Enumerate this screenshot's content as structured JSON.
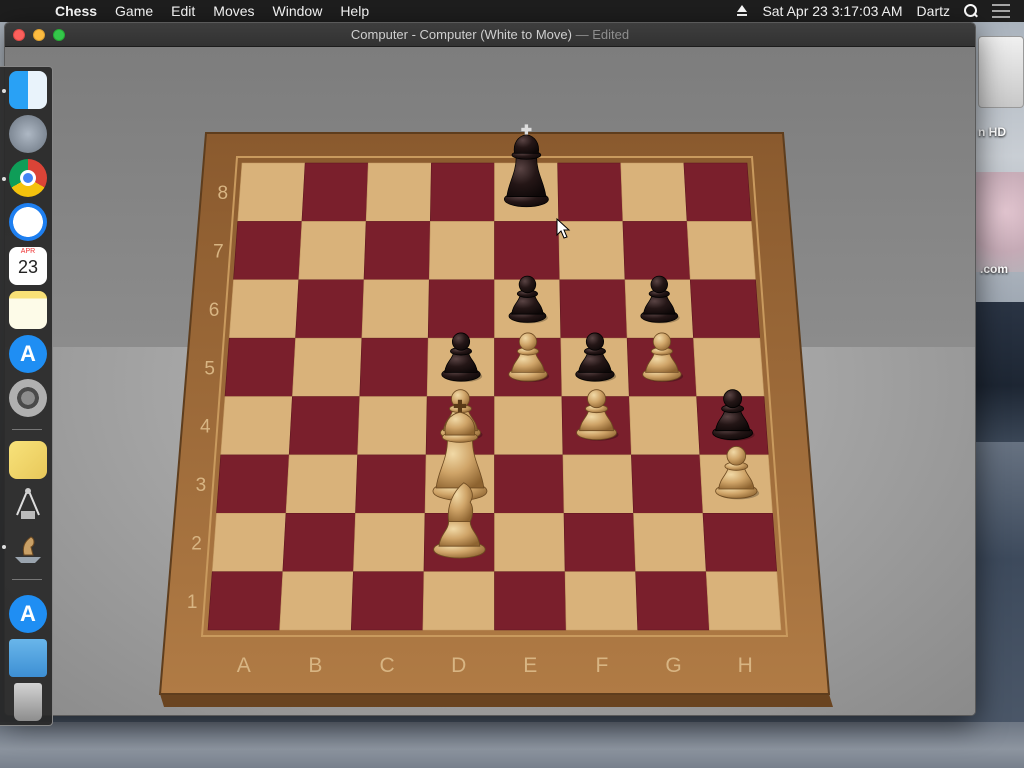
{
  "menubar": {
    "app_name": "Chess",
    "items": [
      "Game",
      "Edit",
      "Moves",
      "Window",
      "Help"
    ],
    "clock": "Sat Apr 23  3:17:03 AM",
    "user": "Dartz"
  },
  "window": {
    "title": "Computer - Computer   (White to Move)",
    "status": "— Edited"
  },
  "desktop": {
    "hd_label": "n HD",
    "com_label": ".com"
  },
  "dock": {
    "calendar_month": "APR",
    "calendar_day": "23"
  },
  "board": {
    "files": [
      "A",
      "B",
      "C",
      "D",
      "E",
      "F",
      "G",
      "H"
    ],
    "ranks": [
      "8",
      "7",
      "6",
      "5",
      "4",
      "3",
      "2",
      "1"
    ],
    "pieces": [
      {
        "color": "black",
        "type": "king",
        "square": "e8"
      },
      {
        "color": "black",
        "type": "pawn",
        "square": "e6"
      },
      {
        "color": "black",
        "type": "pawn",
        "square": "g6"
      },
      {
        "color": "black",
        "type": "pawn",
        "square": "d5"
      },
      {
        "color": "black",
        "type": "pawn",
        "square": "f5"
      },
      {
        "color": "black",
        "type": "pawn",
        "square": "h4"
      },
      {
        "color": "white",
        "type": "pawn",
        "square": "e5"
      },
      {
        "color": "white",
        "type": "pawn",
        "square": "g5"
      },
      {
        "color": "white",
        "type": "pawn",
        "square": "d4"
      },
      {
        "color": "white",
        "type": "pawn",
        "square": "f4"
      },
      {
        "color": "white",
        "type": "king",
        "square": "d3"
      },
      {
        "color": "white",
        "type": "pawn",
        "square": "h3"
      },
      {
        "color": "white",
        "type": "knight",
        "square": "d2"
      }
    ],
    "colors": {
      "dark_square": "#7a1f2c",
      "light_square": "#d9b27a",
      "frame": "#a2703e",
      "black_piece": "#1d1212",
      "white_piece": "#caa066"
    }
  }
}
